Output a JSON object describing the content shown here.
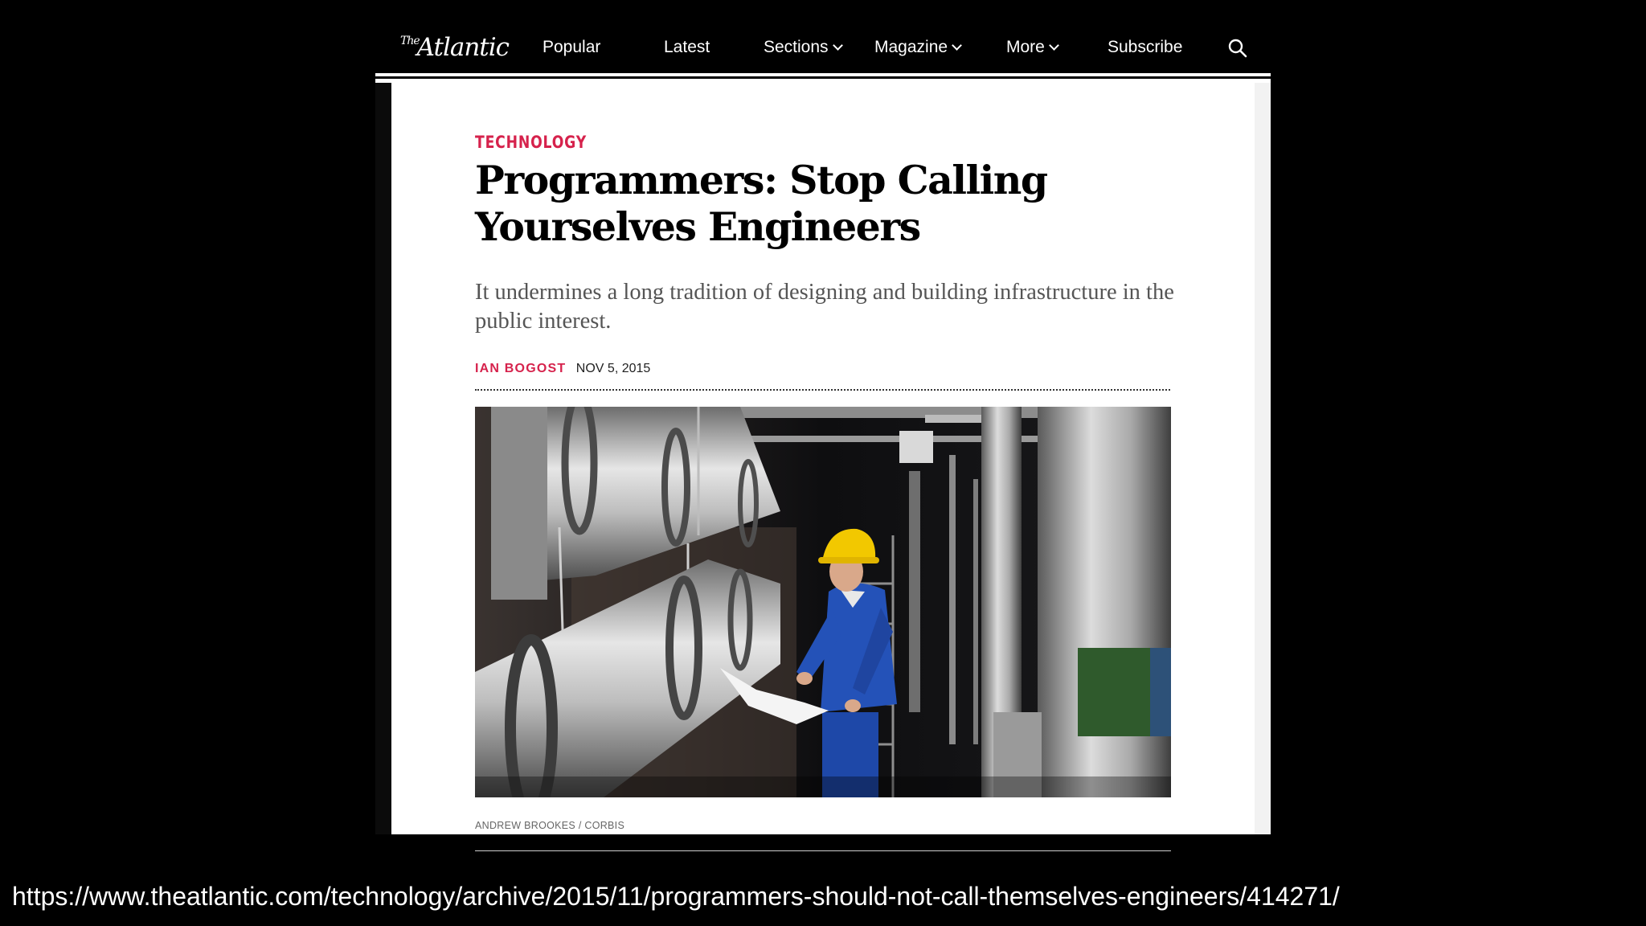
{
  "nav": {
    "logo": "The Atlantic",
    "logo_small": "The",
    "logo_main": "Atlantic",
    "items": [
      {
        "label": "Popular",
        "has_dropdown": false
      },
      {
        "label": "Latest",
        "has_dropdown": false
      },
      {
        "label": "Sections",
        "has_dropdown": true
      },
      {
        "label": "Magazine",
        "has_dropdown": true
      },
      {
        "label": "More",
        "has_dropdown": true
      },
      {
        "label": "Subscribe",
        "has_dropdown": false
      }
    ],
    "search_icon": "search-icon"
  },
  "article": {
    "section": "TECHNOLOGY",
    "headline": "Programmers: Stop Calling Yourselves Engineers",
    "dek": "It undermines a long tradition of designing and building infrastructure in the public interest.",
    "author": "IAN BOGOST",
    "date": "NOV 5, 2015",
    "photo_credit": "ANDREW BROOKES / CORBIS"
  },
  "caption": {
    "url": "https://www.theatlantic.com/technology/archive/2015/11/programmers-should-not-call-themselves-engineers/414271/"
  },
  "colors": {
    "accent": "#d6224c",
    "nav_background": "#000000",
    "slide_background": "#000000"
  }
}
